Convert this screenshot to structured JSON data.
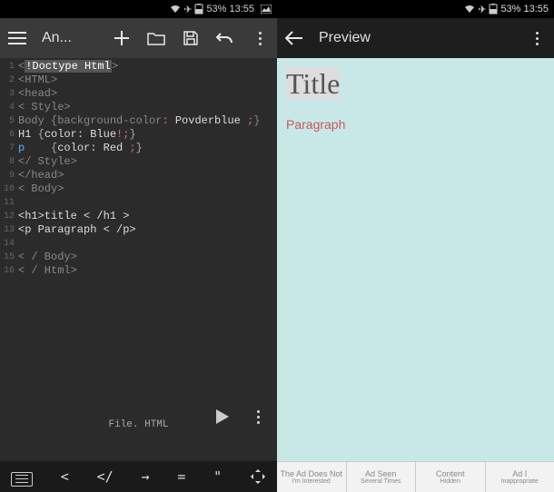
{
  "left": {
    "status": {
      "battery": "53%",
      "time": "13:55"
    },
    "toolbar": {
      "title": "An..."
    },
    "code": {
      "lines": [
        {
          "n": "1",
          "html": "<span class='hl-gray'>&lt;</span><span class='hl-tag'>!Doctype Html</span><span class='hl-gray'>&gt;</span>"
        },
        {
          "n": "2",
          "html": "<span class='hl-gray'>&lt;HTML&gt;</span>"
        },
        {
          "n": "3",
          "html": "<span class='hl-gray'>&lt;head&gt;</span>"
        },
        {
          "n": "4",
          "html": "<span class='hl-gray'>&lt; Style&gt;</span>"
        },
        {
          "n": "5",
          "html": "<span class='hl-gray'>Body {background-color</span><span class='hl-red'>:</span> <span class='hl-white'>Povderblue</span> <span class='hl-red'>;</span><span class='hl-gray'>}</span>"
        },
        {
          "n": "6",
          "html": "<span class='hl-white'>H1 </span><span class='hl-paren'>{</span><span class='hl-white'>color: Blue</span><span class='hl-red'>!</span><span class='hl-red'>;</span><span class='hl-paren'>}</span>"
        },
        {
          "n": "7",
          "html": "<span class='hl-blue'>p    </span><span class='hl-paren'>{</span><span class='hl-white'>color: Red </span><span class='hl-red'>;</span><span class='hl-paren'>}</span>"
        },
        {
          "n": "8",
          "html": "<span class='hl-gray'>&lt;/ Style&gt;</span>"
        },
        {
          "n": "9",
          "html": "<span class='hl-gray'>&lt;/head&gt;</span>"
        },
        {
          "n": "10",
          "html": "<span class='hl-gray'>&lt; Body&gt;</span>"
        },
        {
          "n": "11",
          "html": ""
        },
        {
          "n": "12",
          "html": "<span class='hl-white'>&lt;h1&gt;title &lt; /h1 &gt;</span>"
        },
        {
          "n": "13",
          "html": "<span class='hl-white'>&lt;p Paragraph &lt; /p&gt;</span>"
        },
        {
          "n": "14",
          "html": ""
        },
        {
          "n": "15",
          "html": "<span class='hl-gray'>&lt; / Body&gt;</span>"
        },
        {
          "n": "16",
          "html": "<span class='hl-gray'>&lt; / Html&gt;</span>"
        }
      ],
      "fileLabel": "File. HTML"
    },
    "symbols": {
      "lt": "<",
      "closetag": "</",
      "arrow": "→",
      "eq": "=",
      "quote": "\""
    }
  },
  "right": {
    "status": {
      "battery": "53%",
      "time": "13:55"
    },
    "toolbar": {
      "title": "Preview"
    },
    "preview": {
      "title": "Title",
      "para": "Paragraph"
    },
    "ads": [
      {
        "l1": "The Ad Does Not",
        "l2": "I'm Interested"
      },
      {
        "l1": "Ad Seen",
        "l2": "Several Times"
      },
      {
        "l1": "Content",
        "l2": "Hidden"
      },
      {
        "l1": "Ad I",
        "l2": "Inappropriate"
      }
    ]
  }
}
